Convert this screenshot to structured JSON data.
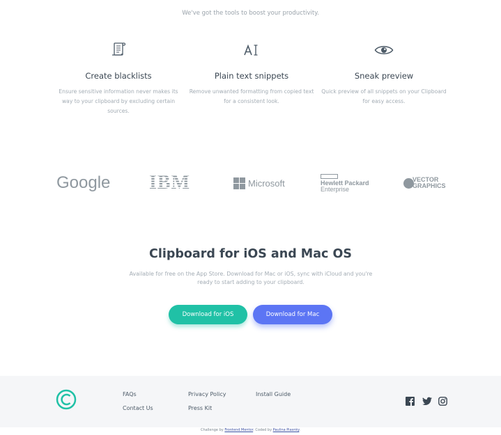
{
  "features_section": {
    "tagline": "We've got the tools to boost your productivity.",
    "items": [
      {
        "icon": "blacklist-icon",
        "title": "Create blacklists",
        "desc": "Ensure sensitive information never makes its way to your clipboard by excluding certain sources."
      },
      {
        "icon": "text-cursor-icon",
        "title": "Plain text snippets",
        "desc": "Remove unwanted formatting from copied text for a consistent look."
      },
      {
        "icon": "eye-icon",
        "title": "Sneak preview",
        "desc": "Quick preview of all snippets on your Clipboard for easy access."
      }
    ]
  },
  "brands": {
    "google": "Google",
    "ibm": "IBM",
    "microsoft": "Microsoft",
    "hp_line1": "Hewlett Packard",
    "hp_line2": "Enterprise",
    "vector_line1": "VECTOR",
    "vector_line2": "GRAPHICS"
  },
  "cta": {
    "title": "Clipboard for iOS and Mac OS",
    "desc": "Available for free on the App Store. Download for Mac or iOS, sync with iCloud and you're ready to start adding to your clipboard.",
    "ios_button": "Download for iOS",
    "mac_button": "Download for Mac"
  },
  "footer": {
    "links": {
      "faqs": "FAQs",
      "contact": "Contact Us",
      "privacy": "Privacy Policy",
      "press": "Press Kit",
      "install": "Install Guide"
    },
    "social": [
      "facebook-icon",
      "twitter-icon",
      "instagram-icon"
    ]
  },
  "attribution": {
    "prefix": "Challenge by",
    "fm": "Frontend Mentor",
    "middle": ". Coded by",
    "author": "Paulina Piasnky",
    "suffix": "."
  },
  "colors": {
    "accent_green": "#20c1a6",
    "accent_blue": "#5c75f4",
    "heading": "#3b4753",
    "muted": "#a3acb4"
  }
}
